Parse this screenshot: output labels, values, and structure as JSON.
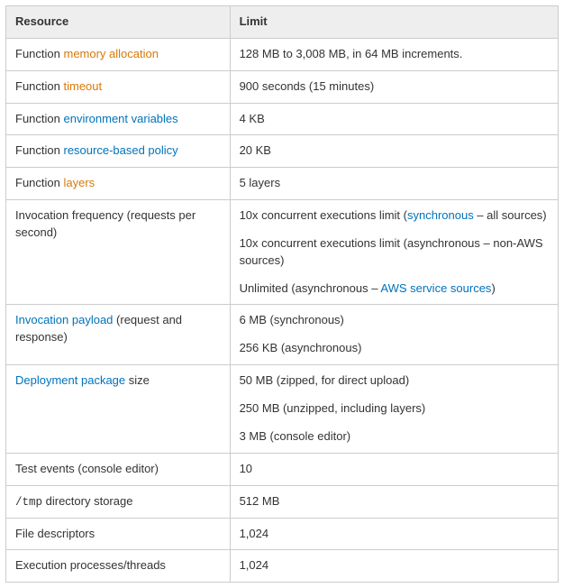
{
  "table": {
    "headers": {
      "resource": "Resource",
      "limit": "Limit"
    },
    "rows": {
      "memory": {
        "prefix": "Function ",
        "link": "memory allocation",
        "limit": "128 MB to 3,008 MB, in 64 MB increments."
      },
      "timeout": {
        "prefix": "Function ",
        "link": "timeout",
        "limit": "900 seconds (15 minutes)"
      },
      "envvars": {
        "prefix": "Function ",
        "link": "environment variables",
        "limit": "4 KB"
      },
      "resourcepolicy": {
        "prefix": "Function ",
        "link": "resource-based policy",
        "limit": "20 KB"
      },
      "layers": {
        "prefix": "Function ",
        "link": "layers",
        "limit": "5 layers"
      },
      "invocationfreq": {
        "label": "Invocation frequency (requests per second)",
        "line1_pre": "10x concurrent executions limit (",
        "line1_link": "synchronous",
        "line1_post": " – all sources)",
        "line2": "10x concurrent executions limit (asynchronous – non-AWS sources)",
        "line3_pre": "Unlimited (asynchronous – ",
        "line3_link": "AWS service sources",
        "line3_post": ")"
      },
      "invocationpayload": {
        "link": "Invocation payload",
        "suffix": " (request and response)",
        "line1": "6 MB (synchronous)",
        "line2": "256 KB (asynchronous)"
      },
      "deployment": {
        "link": "Deployment package",
        "suffix": " size",
        "line1": "50 MB (zipped, for direct upload)",
        "line2": "250 MB (unzipped, including layers)",
        "line3": "3 MB (console editor)"
      },
      "testevents": {
        "label": "Test events (console editor)",
        "limit": "10"
      },
      "tmp": {
        "code": "/tmp",
        "suffix": " directory storage",
        "limit": "512 MB"
      },
      "fds": {
        "label": "File descriptors",
        "limit": "1,024"
      },
      "procs": {
        "label": "Execution processes/threads",
        "limit": "1,024"
      }
    }
  }
}
